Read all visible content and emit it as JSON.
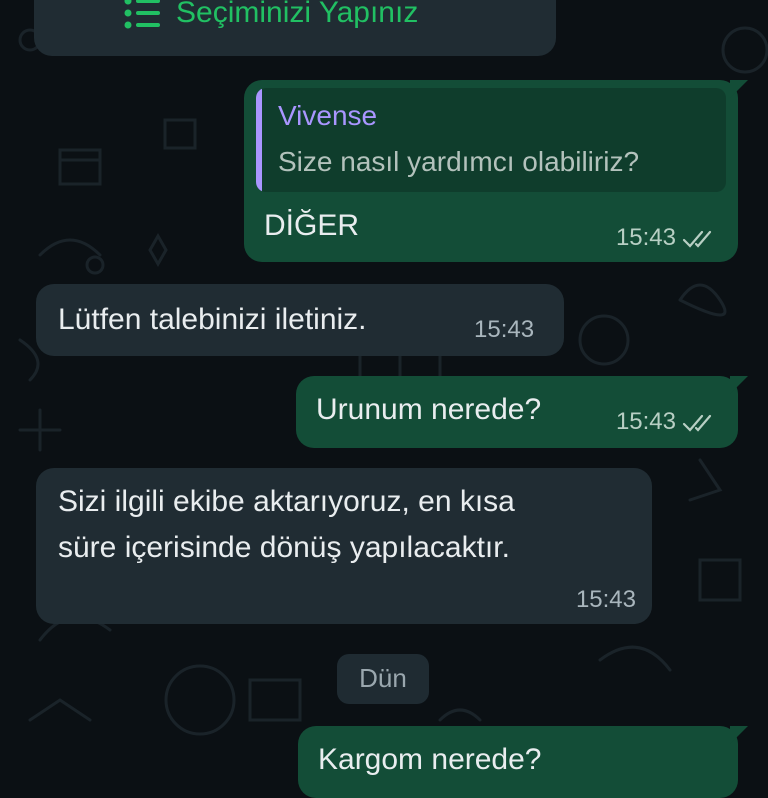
{
  "list_button": {
    "label": "Seçiminizi Yapınız",
    "icon": "list-icon"
  },
  "messages": [
    {
      "direction": "outgoing",
      "quote": {
        "sender": "Vivense",
        "text": "Size nasıl yardımcı olabiliriz?"
      },
      "text": "DİĞER",
      "time": "15:43",
      "status": "read"
    },
    {
      "direction": "incoming",
      "text": "Lütfen talebinizi iletiniz.",
      "time": "15:43"
    },
    {
      "direction": "outgoing",
      "text": "Urunum nerede?",
      "time": "15:43",
      "status": "read"
    },
    {
      "direction": "incoming",
      "lines": [
        "Sizi ilgili ekibe aktarıyoruz, en kısa",
        "süre içerisinde dönüş yapılacaktır."
      ],
      "time": "15:43"
    },
    {
      "direction": "outgoing",
      "text": "Kargom nerede?"
    }
  ],
  "day_separator": "Dün",
  "colors": {
    "background": "#0b1014",
    "incoming_bubble": "#202c33",
    "outgoing_bubble": "#134d37",
    "accent_green": "#21c063",
    "quote_sender": "#a996ff",
    "ticks_read": "#b8cfc4"
  }
}
